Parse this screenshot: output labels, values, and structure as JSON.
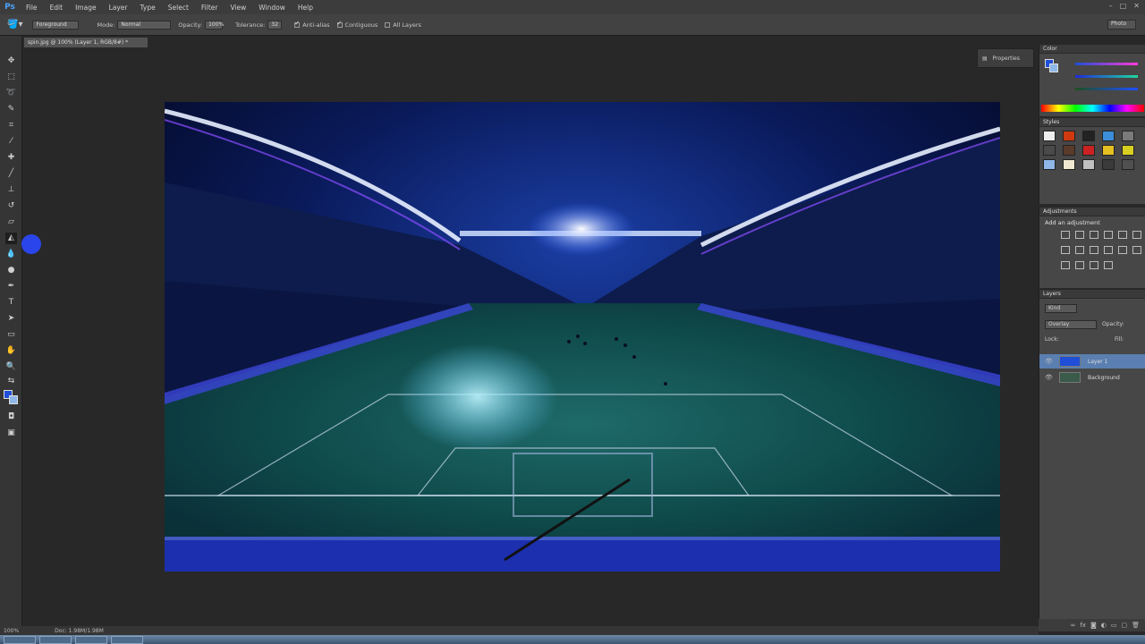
{
  "app": {
    "logo": "Ps",
    "menu": [
      "File",
      "Edit",
      "Image",
      "Layer",
      "Type",
      "Select",
      "Filter",
      "View",
      "Window",
      "Help"
    ]
  },
  "options": {
    "fill_source": "Foreground",
    "mode_label": "Mode:",
    "mode_value": "Normal",
    "opacity_label": "Opacity:",
    "opacity_value": "100%",
    "tolerance_label": "Tolerance:",
    "tolerance_value": "32",
    "antialias_label": "Anti-alias",
    "contiguous_label": "Contiguous",
    "all_layers_label": "All Layers",
    "workspace": "Photo"
  },
  "document": {
    "tab_title": "spin.jpg @ 100% (Layer 1, RGB/8#) *"
  },
  "panels": {
    "properties_label": "Properties",
    "color_tab": "Color",
    "swatches_tab": "Swatches",
    "styles_tab": "Styles",
    "adjustments_tab": "Adjustments",
    "add_adjustment": "Add an adjustment",
    "layers_tab": "Layers",
    "kind_label": "Kind",
    "blend_mode": "Overlay",
    "opacity_label": "Opacity:",
    "lock_label": "Lock:",
    "fill_label": "Fill:",
    "layers": [
      {
        "name": "Layer 1",
        "selected": true,
        "thumb_color": "#1f4fd8"
      },
      {
        "name": "Background",
        "selected": false,
        "thumb_color": "#3a5a4a"
      }
    ]
  },
  "status": {
    "zoom": "100%",
    "doc_info": "Doc: 1.98M/1.98M"
  },
  "colors": {
    "foreground": "#1f4fd8",
    "background": "#8fb8e8"
  }
}
